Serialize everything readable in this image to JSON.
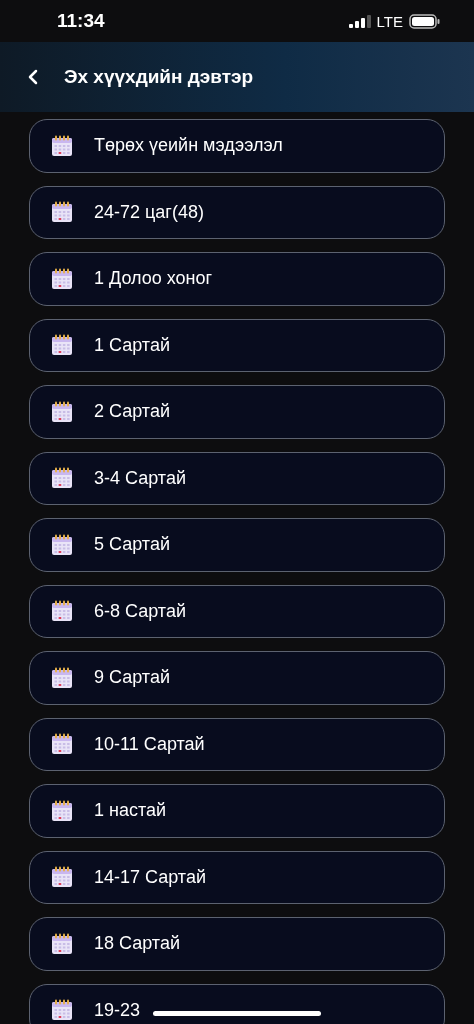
{
  "status_bar": {
    "time": "11:34",
    "network": "LTE"
  },
  "header": {
    "title": "Эх хүүхдийн дэвтэр"
  },
  "items": [
    {
      "label": "Төрөх үеийн мэдээлэл"
    },
    {
      "label": "24-72 цаг(48)"
    },
    {
      "label": "1 Долоо хоног"
    },
    {
      "label": "1 Сартай"
    },
    {
      "label": "2 Сартай"
    },
    {
      "label": "3-4 Сартай"
    },
    {
      "label": "5 Сартай"
    },
    {
      "label": "6-8 Сартай"
    },
    {
      "label": "9 Сартай"
    },
    {
      "label": "10-11 Сартай"
    },
    {
      "label": "1 настай"
    },
    {
      "label": "14-17 Сартай"
    },
    {
      "label": "18 Сартай"
    },
    {
      "label": "19-23"
    }
  ]
}
